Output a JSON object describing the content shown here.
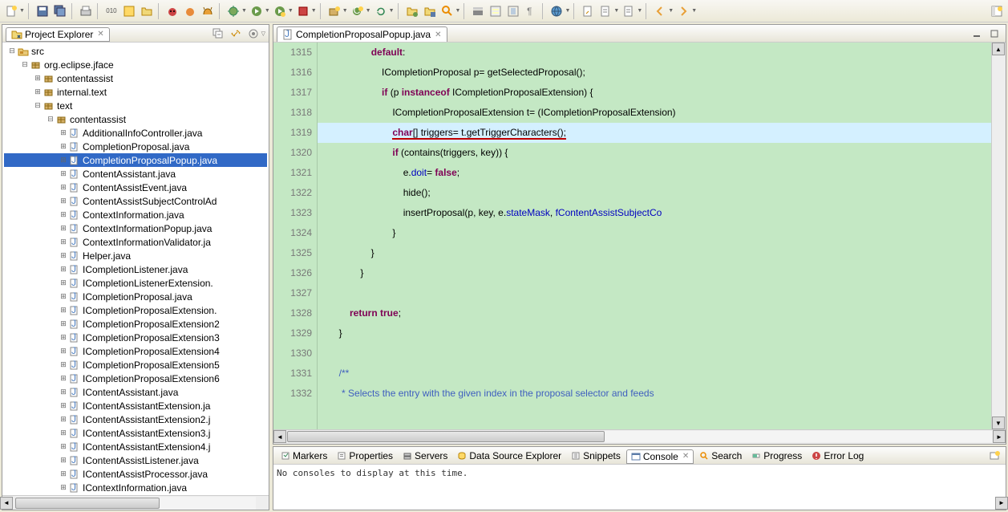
{
  "explorer": {
    "title": "Project Explorer",
    "tree": [
      {
        "indent": 0,
        "exp": "−",
        "icon": "src",
        "label": "src"
      },
      {
        "indent": 1,
        "exp": "−",
        "icon": "pkg",
        "label": "org.eclipse.jface"
      },
      {
        "indent": 2,
        "exp": "+",
        "icon": "pkg",
        "label": "contentassist"
      },
      {
        "indent": 2,
        "exp": "+",
        "icon": "pkg",
        "label": "internal.text"
      },
      {
        "indent": 2,
        "exp": "−",
        "icon": "pkg",
        "label": "text"
      },
      {
        "indent": 3,
        "exp": "−",
        "icon": "pkg",
        "label": "contentassist"
      },
      {
        "indent": 4,
        "exp": "+",
        "icon": "java",
        "label": "AdditionalInfoController.java"
      },
      {
        "indent": 4,
        "exp": "+",
        "icon": "java",
        "label": "CompletionProposal.java"
      },
      {
        "indent": 4,
        "exp": "+",
        "icon": "java",
        "label": "CompletionProposalPopup.java",
        "selected": true
      },
      {
        "indent": 4,
        "exp": "+",
        "icon": "java",
        "label": "ContentAssistant.java"
      },
      {
        "indent": 4,
        "exp": "+",
        "icon": "java",
        "label": "ContentAssistEvent.java"
      },
      {
        "indent": 4,
        "exp": "+",
        "icon": "java",
        "label": "ContentAssistSubjectControlAd"
      },
      {
        "indent": 4,
        "exp": "+",
        "icon": "java",
        "label": "ContextInformation.java"
      },
      {
        "indent": 4,
        "exp": "+",
        "icon": "java",
        "label": "ContextInformationPopup.java"
      },
      {
        "indent": 4,
        "exp": "+",
        "icon": "java",
        "label": "ContextInformationValidator.ja"
      },
      {
        "indent": 4,
        "exp": "+",
        "icon": "java",
        "label": "Helper.java"
      },
      {
        "indent": 4,
        "exp": "+",
        "icon": "java",
        "label": "ICompletionListener.java"
      },
      {
        "indent": 4,
        "exp": "+",
        "icon": "java",
        "label": "ICompletionListenerExtension."
      },
      {
        "indent": 4,
        "exp": "+",
        "icon": "java",
        "label": "ICompletionProposal.java"
      },
      {
        "indent": 4,
        "exp": "+",
        "icon": "java",
        "label": "ICompletionProposalExtension."
      },
      {
        "indent": 4,
        "exp": "+",
        "icon": "java",
        "label": "ICompletionProposalExtension2"
      },
      {
        "indent": 4,
        "exp": "+",
        "icon": "java",
        "label": "ICompletionProposalExtension3"
      },
      {
        "indent": 4,
        "exp": "+",
        "icon": "java",
        "label": "ICompletionProposalExtension4"
      },
      {
        "indent": 4,
        "exp": "+",
        "icon": "java",
        "label": "ICompletionProposalExtension5"
      },
      {
        "indent": 4,
        "exp": "+",
        "icon": "java",
        "label": "ICompletionProposalExtension6"
      },
      {
        "indent": 4,
        "exp": "+",
        "icon": "java",
        "label": "IContentAssistant.java"
      },
      {
        "indent": 4,
        "exp": "+",
        "icon": "java",
        "label": "IContentAssistantExtension.ja"
      },
      {
        "indent": 4,
        "exp": "+",
        "icon": "java",
        "label": "IContentAssistantExtension2.j"
      },
      {
        "indent": 4,
        "exp": "+",
        "icon": "java",
        "label": "IContentAssistantExtension3.j"
      },
      {
        "indent": 4,
        "exp": "+",
        "icon": "java",
        "label": "IContentAssistantExtension4.j"
      },
      {
        "indent": 4,
        "exp": "+",
        "icon": "java",
        "label": "IContentAssistListener.java"
      },
      {
        "indent": 4,
        "exp": "+",
        "icon": "java",
        "label": "IContentAssistProcessor.java"
      },
      {
        "indent": 4,
        "exp": "+",
        "icon": "java",
        "label": "IContextInformation.java"
      }
    ]
  },
  "editor": {
    "tab": "CompletionProposalPopup.java",
    "lines": [
      {
        "n": 1315,
        "html": "                    <span class='kw'>default</span>:"
      },
      {
        "n": 1316,
        "html": "                        ICompletionProposal p= getSelectedProposal();"
      },
      {
        "n": 1317,
        "html": "                        <span class='kw'>if</span> (p <span class='kw'>instanceof</span> ICompletionProposalExtension) {"
      },
      {
        "n": 1318,
        "html": "                            ICompletionProposalExtension t= (ICompletionProposalExtension)"
      },
      {
        "n": 1319,
        "html": "                            <span class='underline'><span class='kw'>char</span>[] triggers= t.getTriggerCharacters();</span>",
        "hl": true
      },
      {
        "n": 1320,
        "html": "                            <span class='kw'>if</span> (contains(triggers, key)) {"
      },
      {
        "n": 1321,
        "html": "                                e.<span class='field'>doit</span>= <span class='kw'>false</span>;"
      },
      {
        "n": 1322,
        "html": "                                hide();"
      },
      {
        "n": 1323,
        "html": "                                insertProposal(p, key, e.<span class='field'>stateMask</span>, <span class='field'>fContentAssistSubjectCo</span>"
      },
      {
        "n": 1324,
        "html": "                            }"
      },
      {
        "n": 1325,
        "html": "                    }"
      },
      {
        "n": 1326,
        "html": "                }"
      },
      {
        "n": 1327,
        "html": ""
      },
      {
        "n": 1328,
        "html": "            <span class='kw'>return true</span>;"
      },
      {
        "n": 1329,
        "html": "        }"
      },
      {
        "n": 1330,
        "html": ""
      },
      {
        "n": 1331,
        "html": "        <span class='comment'>/**</span>"
      },
      {
        "n": 1332,
        "html": "<span class='comment'>         * Selects the entry with the given index in the proposal selector and feeds</span>"
      }
    ]
  },
  "bottom": {
    "tabs": [
      "Markers",
      "Properties",
      "Servers",
      "Data Source Explorer",
      "Snippets",
      "Console",
      "Search",
      "Progress",
      "Error Log"
    ],
    "active": 5,
    "console_msg": "No consoles to display at this time."
  }
}
